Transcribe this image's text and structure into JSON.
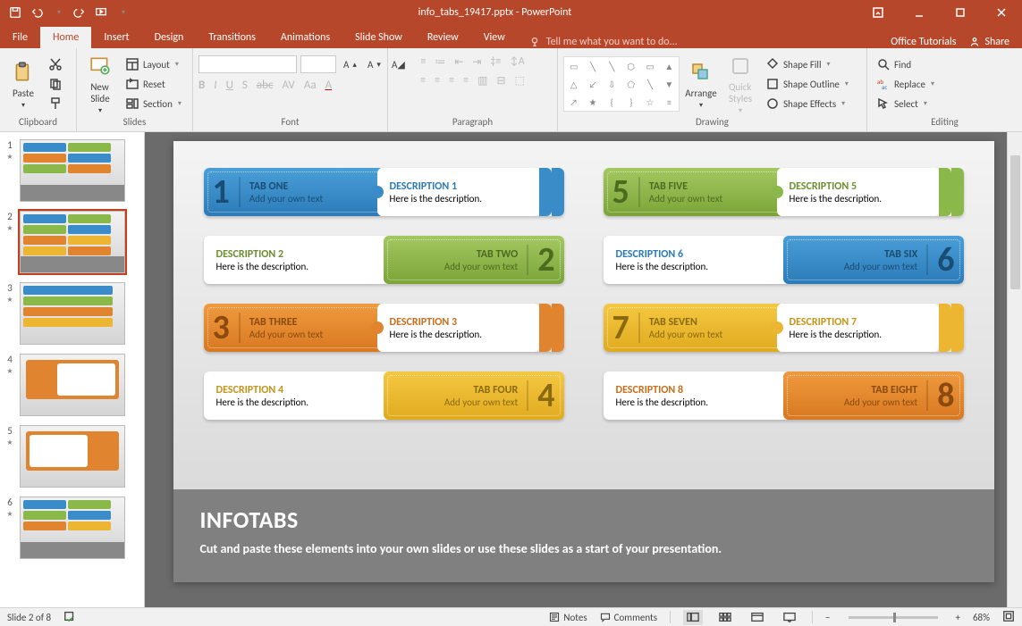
{
  "title": "info_tabs_19417.pptx - PowerPoint",
  "qat": {
    "save": "Save",
    "undo": "Undo",
    "redo": "Redo",
    "start": "Start From Beginning"
  },
  "menutabs": {
    "file": "File",
    "home": "Home",
    "insert": "Insert",
    "design": "Design",
    "transitions": "Transitions",
    "animations": "Animations",
    "slideshow": "Slide Show",
    "review": "Review",
    "view": "View"
  },
  "tellme": "Tell me what you want to do...",
  "rightmenu": {
    "tutorials": "Office Tutorials",
    "share": "Share"
  },
  "ribbon": {
    "clipboard": {
      "label": "Clipboard",
      "paste": "Paste",
      "cut": "Cut",
      "copy": "Copy",
      "format_painter": "Format Painter"
    },
    "slides": {
      "label": "Slides",
      "new_slide": "New\nSlide",
      "layout": "Layout",
      "reset": "Reset",
      "section": "Section"
    },
    "font": {
      "label": "Font"
    },
    "paragraph": {
      "label": "Paragraph"
    },
    "drawing": {
      "label": "Drawing",
      "arrange": "Arrange",
      "quick_styles": "Quick\nStyles",
      "shape_fill": "Shape Fill",
      "shape_outline": "Shape Outline",
      "shape_effects": "Shape Effects"
    },
    "editing": {
      "label": "Editing",
      "find": "Find",
      "replace": "Replace",
      "select": "Select"
    }
  },
  "thumbnails": {
    "count": 6,
    "selected": 2
  },
  "slide": {
    "tabs": [
      {
        "num": "1",
        "title": "TAB ONE",
        "sub": "Add your own text",
        "dtitle": "DESCRIPTION 1",
        "dtext": "Here is the description.",
        "color": "blue",
        "rev": false
      },
      {
        "num": "5",
        "title": "TAB FIVE",
        "sub": "Add your own text",
        "dtitle": "DESCRIPTION 5",
        "dtext": "Here is the description.",
        "color": "green",
        "rev": false
      },
      {
        "num": "2",
        "title": "TAB TWO",
        "sub": "Add your own text",
        "dtitle": "DESCRIPTION 2",
        "dtext": "Here is the description.",
        "color": "green",
        "rev": true
      },
      {
        "num": "6",
        "title": "TAB SIX",
        "sub": "Add your own text",
        "dtitle": "DESCRIPTION 6",
        "dtext": "Here is the description.",
        "color": "blue",
        "rev": true
      },
      {
        "num": "3",
        "title": "TAB THREE",
        "sub": "Add your own text",
        "dtitle": "DESCRIPTION 3",
        "dtext": "Here is the description.",
        "color": "orange",
        "rev": false
      },
      {
        "num": "7",
        "title": "TAB SEVEN",
        "sub": "Add your own text",
        "dtitle": "DESCRIPTION 7",
        "dtext": "Here is the description.",
        "color": "yellow",
        "rev": false
      },
      {
        "num": "4",
        "title": "TAB FOUR",
        "sub": "Add your own text",
        "dtitle": "DESCRIPTION 4",
        "dtext": "Here is the description.",
        "color": "yellow",
        "rev": true
      },
      {
        "num": "8",
        "title": "TAB EIGHT",
        "sub": "Add your own text",
        "dtitle": "DESCRIPTION 8",
        "dtext": "Here is the description.",
        "color": "orange",
        "rev": true
      }
    ],
    "footer_title": "INFOTABS",
    "footer_text": "Cut and paste these elements into your own slides or use these slides as a start of your presentation."
  },
  "statusbar": {
    "slide_indicator": "Slide 2 of 8",
    "notes": "Notes",
    "comments": "Comments",
    "zoom": "68%"
  },
  "colors": {
    "blue": "#3a8cc9",
    "green": "#8bb84a",
    "orange": "#e08430",
    "yellow": "#ecb632"
  }
}
